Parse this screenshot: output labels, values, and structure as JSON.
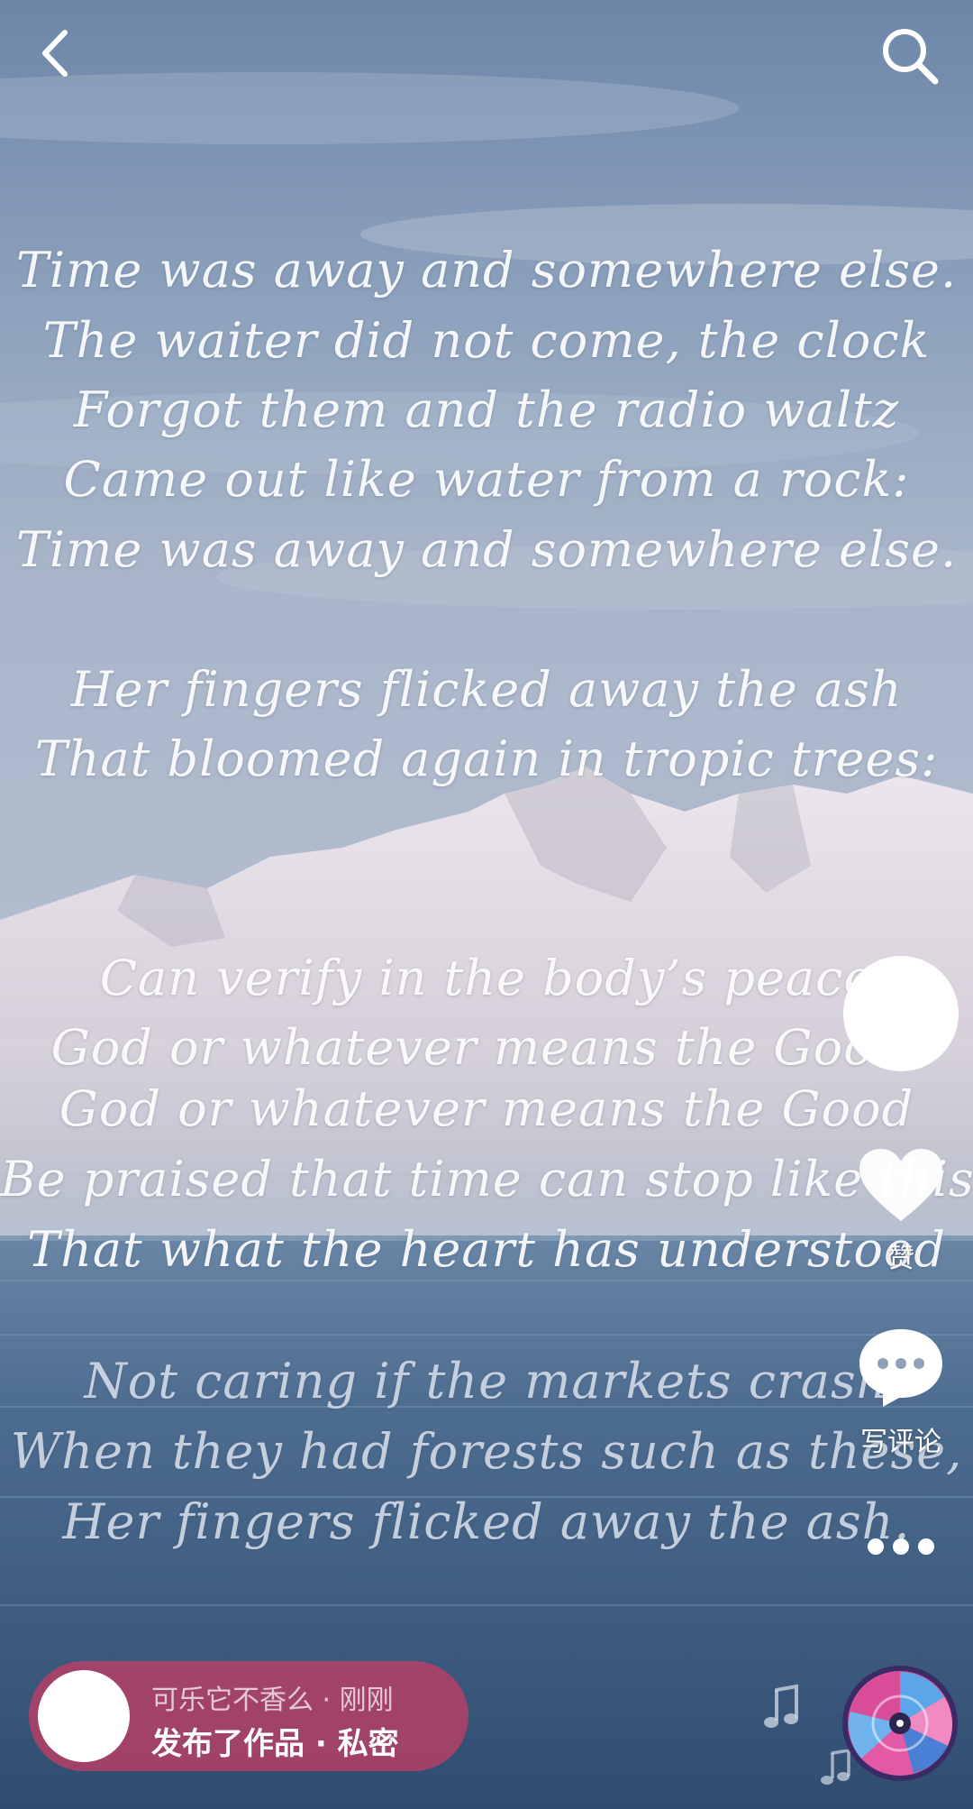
{
  "top_bar": {
    "back_icon": "chevron-left-icon",
    "search_icon": "search-icon"
  },
  "poem": {
    "lines": [
      "Time was away and somewhere else.",
      "The waiter did not come, the clock",
      "Forgot them and the radio waltz",
      "Came out like water from a rock:",
      "Time was away and somewhere else.",
      "",
      "Her fingers flicked away the ash",
      "That bloomed again in tropic trees:",
      "",
      "",
      "Can verify in the body’s peace",
      "God or whatever means the Good.",
      "God or whatever means the Good",
      "Be praised that time can stop like this,",
      "That what the heart has understood",
      "",
      "Not caring if the markets crash",
      "When they had forests such as these,",
      "Her fingers flicked away the ash."
    ]
  },
  "side_rail": {
    "like_label": "赞",
    "comment_label": "写评论",
    "like_icon": "heart-icon",
    "comment_icon": "speech-bubble-icon",
    "more_icon": "more-dots-icon"
  },
  "publish": {
    "user_line": "可乐它不香么 · 刚刚",
    "status_line": "发布了作品 · 私密"
  },
  "colors": {
    "pill_bg": "#cc3c64",
    "text": "#ffffff"
  }
}
